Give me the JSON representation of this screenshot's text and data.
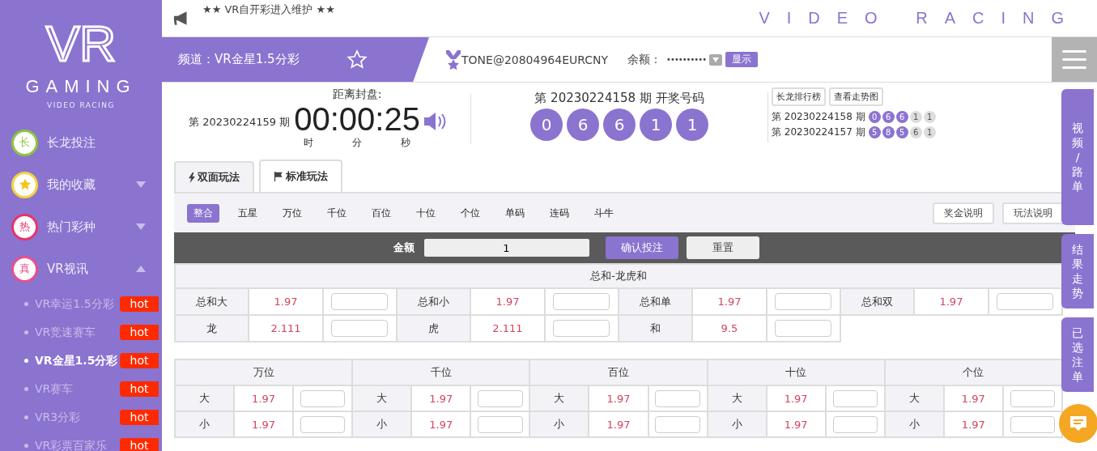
{
  "sidebar": {
    "logo_mark": "VR",
    "logo_word": "GAMING",
    "logo_sub": "VIDEO RACING",
    "menu": [
      {
        "kind": "link",
        "badge": "长",
        "label": "长龙投注",
        "color": "#8cc63f"
      },
      {
        "kind": "group",
        "label": "我的收藏",
        "color": "#f5d33f",
        "expanded": false
      },
      {
        "kind": "group",
        "badge": "热",
        "label": "热门彩种",
        "color": "#e8336b",
        "expanded": false
      },
      {
        "kind": "group",
        "badge": "真",
        "label": "VR视讯",
        "color": "#e8508a",
        "expanded": true
      }
    ],
    "games": [
      {
        "label": "VR幸运1.5分彩",
        "tag": "hot",
        "selected": false
      },
      {
        "label": "VR竞速赛车",
        "tag": "hot",
        "selected": false
      },
      {
        "label": "VR金星1.5分彩",
        "tag": "hot",
        "selected": true
      },
      {
        "label": "VR赛车",
        "tag": "hot",
        "selected": false
      },
      {
        "label": "VR3分彩",
        "tag": "hot",
        "selected": false
      },
      {
        "label": "VR彩票百家乐",
        "tag": "hot",
        "selected": false
      }
    ]
  },
  "notice": "★★ VR自开彩进入维护 ★★",
  "brand": "VIDEO RACING",
  "channel": {
    "label": "频道：VR金星1.5分彩"
  },
  "user": {
    "name": "TONE@20804964EURCNY",
    "balance_label": "余额：",
    "balance": "••••••••••",
    "show_button": "显示"
  },
  "countdown": {
    "period": "第 20230224159 期",
    "title": "距离封盘:",
    "time": "00:00:25",
    "units": [
      "时",
      "分",
      "秒"
    ]
  },
  "latest": {
    "title": "第 20230224158 期  开奖号码",
    "balls": [
      "0",
      "6",
      "6",
      "1",
      "1"
    ]
  },
  "history": {
    "buttons": [
      "长龙排行榜",
      "查看走势图"
    ],
    "rows": [
      {
        "period": "第 20230224158 期",
        "balls": [
          {
            "n": "0",
            "highlighted": true
          },
          {
            "n": "6",
            "highlighted": true
          },
          {
            "n": "6",
            "highlighted": true
          },
          {
            "n": "1",
            "highlighted": false
          },
          {
            "n": "1",
            "highlighted": false
          }
        ]
      },
      {
        "period": "第 20230224157 期",
        "balls": [
          {
            "n": "5",
            "highlighted": true
          },
          {
            "n": "8",
            "highlighted": true
          },
          {
            "n": "5",
            "highlighted": true
          },
          {
            "n": "6",
            "highlighted": false
          },
          {
            "n": "1",
            "highlighted": false
          }
        ]
      }
    ]
  },
  "tabs": [
    {
      "label": "双面玩法",
      "kind": "bolt",
      "selected": false
    },
    {
      "label": "标准玩法",
      "kind": "flag",
      "selected": true
    }
  ],
  "subnav": [
    {
      "label": "整合",
      "selected": true
    },
    {
      "label": "五星",
      "selected": false
    },
    {
      "label": "万位",
      "selected": false
    },
    {
      "label": "千位",
      "selected": false
    },
    {
      "label": "百位",
      "selected": false
    },
    {
      "label": "十位",
      "selected": false
    },
    {
      "label": "个位",
      "selected": false
    },
    {
      "label": "单码",
      "selected": false
    },
    {
      "label": "连码",
      "selected": false
    },
    {
      "label": "斗牛",
      "selected": false
    }
  ],
  "help_buttons": [
    "奖金说明",
    "玩法说明"
  ],
  "bet_bar": {
    "amount_label": "金额",
    "amount": "1",
    "confirm": "确认投注",
    "reset": "重置"
  },
  "sum_table": {
    "title": "总和-龙虎和",
    "rows": [
      [
        {
          "label": "总和大",
          "odds": "1.97"
        },
        {
          "label": "总和小",
          "odds": "1.97"
        },
        {
          "label": "总和单",
          "odds": "1.97"
        },
        {
          "label": "总和双",
          "odds": "1.97"
        }
      ],
      [
        {
          "label": "龙",
          "odds": "2.111"
        },
        {
          "label": "虎",
          "odds": "2.111"
        },
        {
          "label": "和",
          "odds": "9.5"
        }
      ]
    ]
  },
  "positions": [
    {
      "title": "万位",
      "rows": [
        {
          "label": "大",
          "odds": "1.97"
        },
        {
          "label": "小",
          "odds": "1.97"
        }
      ]
    },
    {
      "title": "千位",
      "rows": [
        {
          "label": "大",
          "odds": "1.97"
        },
        {
          "label": "小",
          "odds": "1.97"
        }
      ]
    },
    {
      "title": "百位",
      "rows": [
        {
          "label": "大",
          "odds": "1.97"
        },
        {
          "label": "小",
          "odds": "1.97"
        }
      ]
    },
    {
      "title": "十位",
      "rows": [
        {
          "label": "大",
          "odds": "1.97"
        },
        {
          "label": "小",
          "odds": "1.97"
        }
      ]
    },
    {
      "title": "个位",
      "rows": [
        {
          "label": "大",
          "odds": "1.97"
        },
        {
          "label": "小",
          "odds": "1.97"
        }
      ]
    }
  ],
  "side_tabs": [
    "视频/路单",
    "结果走势",
    "已选注单"
  ]
}
